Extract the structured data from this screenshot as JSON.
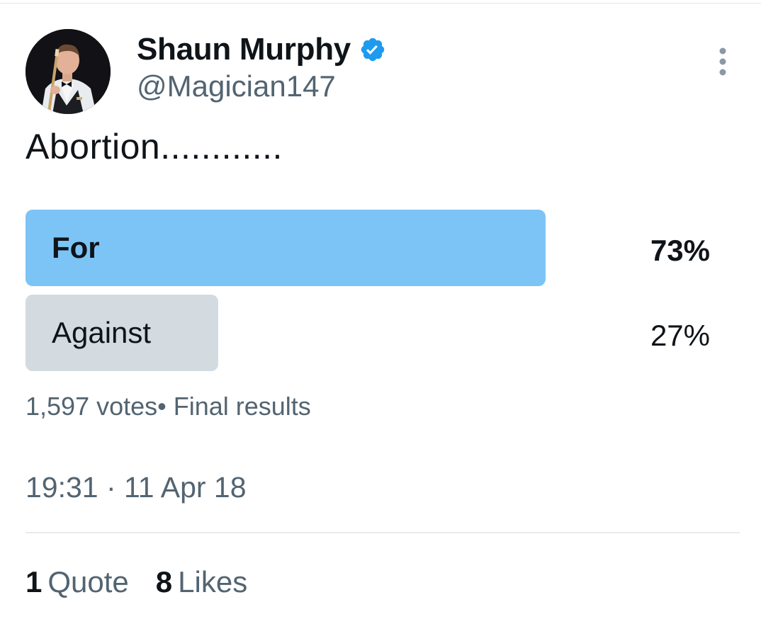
{
  "tweet": {
    "display_name": "Shaun Murphy",
    "handle": "@Magician147",
    "text": "Abortion............",
    "verified_icon": "verified-badge-icon",
    "more_icon": "more-vertical-icon"
  },
  "poll": {
    "options": [
      {
        "label": "For",
        "percent_text": "73%",
        "percent": 73,
        "winner": true,
        "color": "#7cc4f5"
      },
      {
        "label": "Against",
        "percent_text": "27%",
        "percent": 27,
        "winner": false,
        "color": "#d3dbe0"
      }
    ],
    "meta": "1,597 votes• Final results"
  },
  "timestamp": "19:31 · 11 Apr 18",
  "stats": {
    "quotes_count": "1",
    "quotes_label": "Quote",
    "likes_count": "8",
    "likes_label": "Likes"
  },
  "colors": {
    "accent": "#1d9bf0",
    "secondary_text": "#536471"
  }
}
